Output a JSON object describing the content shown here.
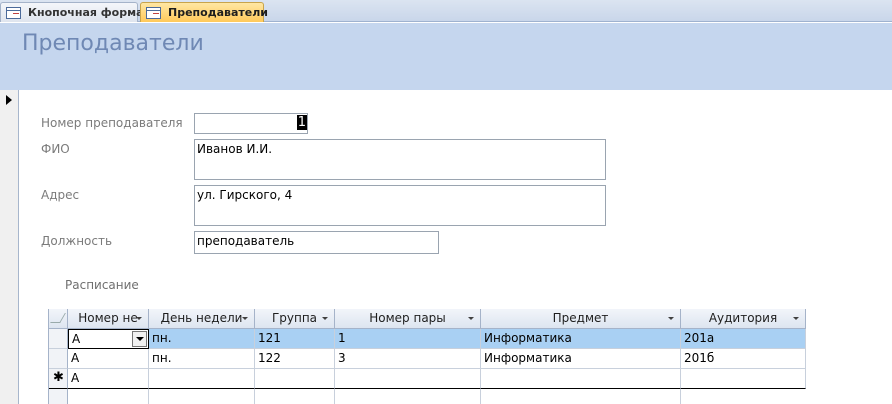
{
  "tabs": [
    {
      "label": "Кнопочная форма",
      "active": false
    },
    {
      "label": "Преподаватели",
      "active": true
    }
  ],
  "form": {
    "title": "Преподаватели",
    "fields": {
      "teacher_number": {
        "label": "Номер преподавателя",
        "value": "1"
      },
      "fio": {
        "label": "ФИО",
        "value": "Иванов И.И."
      },
      "address": {
        "label": "Адрес",
        "value": "ул. Гирского, 4"
      },
      "position": {
        "label": "Должность",
        "value": "преподаватель"
      }
    }
  },
  "subform": {
    "label": "Расписание",
    "columns": [
      "Номер не",
      "День недели",
      "Группа",
      "Номер пары",
      "Предмет",
      "Аудитория"
    ],
    "rows": [
      [
        "А",
        "пн.",
        "121",
        "1",
        "Информатика",
        "201а"
      ],
      [
        "А",
        "пн.",
        "122",
        "3",
        "Информатика",
        "201б"
      ]
    ],
    "new_row": [
      "А",
      "",
      "",
      "",
      "",
      ""
    ],
    "new_row_marker": "✱"
  },
  "colors": {
    "header_bg": "#c5d6ee",
    "title_color": "#6f88b4",
    "active_tab": "#ffc95a",
    "selected_row": "#a9d0f3"
  }
}
